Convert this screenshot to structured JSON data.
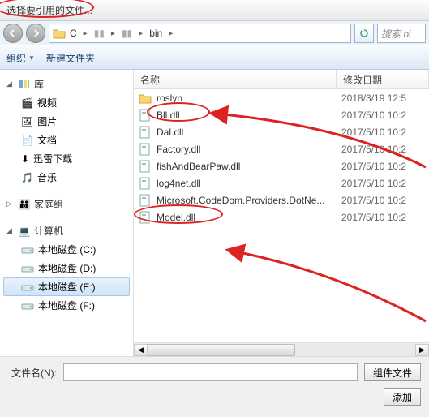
{
  "title": "选择要引用的文件...",
  "breadcrumb": {
    "seg1": "C",
    "seg2": "",
    "seg3": "",
    "seg4": "bin"
  },
  "search_placeholder": "搜索 bi",
  "toolbar": {
    "organize": "组织",
    "newfolder": "新建文件夹"
  },
  "sidebar": {
    "lib": {
      "head": "库",
      "items": [
        "视频",
        "图片",
        "文档",
        "迅雷下载",
        "音乐"
      ]
    },
    "home": {
      "head": "家庭组"
    },
    "pc": {
      "head": "计算机",
      "items": [
        "本地磁盘 (C:)",
        "本地磁盘 (D:)",
        "本地磁盘 (E:)",
        "本地磁盘 (F:)"
      ]
    }
  },
  "columns": {
    "name": "名称",
    "date": "修改日期"
  },
  "files": [
    {
      "name": "roslyn",
      "date": "2018/3/19 12:5",
      "type": "folder"
    },
    {
      "name": "Bll.dll",
      "date": "2017/5/10 10:2",
      "type": "dll"
    },
    {
      "name": "Dal.dll",
      "date": "2017/5/10 10:2",
      "type": "dll"
    },
    {
      "name": "Factory.dll",
      "date": "2017/5/10 10:2",
      "type": "dll"
    },
    {
      "name": "fishAndBearPaw.dll",
      "date": "2017/5/10 10:2",
      "type": "dll"
    },
    {
      "name": "log4net.dll",
      "date": "2017/5/10 10:2",
      "type": "dll"
    },
    {
      "name": "Microsoft.CodeDom.Providers.DotNe...",
      "date": "2017/5/10 10:2",
      "type": "dll"
    },
    {
      "name": "Model.dll",
      "date": "2017/5/10 10:2",
      "type": "dll"
    }
  ],
  "bottom": {
    "label": "文件名(N):",
    "combo": "组件文件",
    "add": "添加"
  },
  "icons": {
    "video": "🎬",
    "pic": "🖼",
    "doc": "📄",
    "thunder": "⬇",
    "music": "🎵",
    "home": "👪",
    "pc": "💻"
  }
}
